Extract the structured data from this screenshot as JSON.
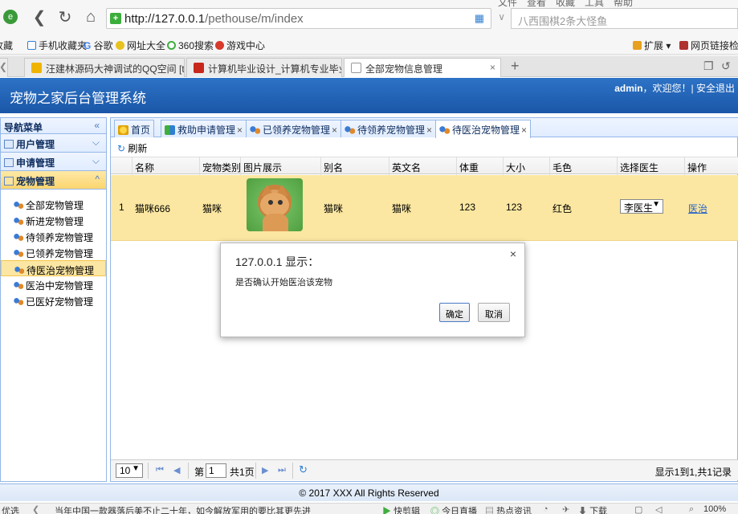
{
  "browser": {
    "top_menu": "文件　查看　收藏　工具　帮助",
    "url_host": "http://127.0.0.1",
    "url_path": "/pethouse/m/index",
    "search_text": "八西围棋2条大怪鱼",
    "bookmarks": {
      "collection": "收藏",
      "mobile": "手机收藏夹",
      "google": "谷歌",
      "daquan": "网址大全",
      "search360": "360搜索",
      "games": "游戏中心",
      "extend": "扩展",
      "translate": "网页链接检"
    },
    "tabs": [
      {
        "label": "汪建林源码大神调试的QQ空间 [t"
      },
      {
        "label": "计算机毕业设计_计算机专业毕业"
      },
      {
        "label": "全部宠物信息管理"
      }
    ]
  },
  "app": {
    "title": "宠物之家后台管理系统",
    "user": "admin",
    "welcome": "，欢迎您！| 安全退出"
  },
  "sidebar": {
    "header": "导航菜单",
    "groups": [
      {
        "label": "用户管理"
      },
      {
        "label": "申请管理"
      },
      {
        "label": "宠物管理"
      }
    ],
    "items": [
      {
        "label": "全部宠物管理"
      },
      {
        "label": "新进宠物管理"
      },
      {
        "label": "待领养宠物管理"
      },
      {
        "label": "已领养宠物管理"
      },
      {
        "label": "待医治宠物管理"
      },
      {
        "label": "医治中宠物管理"
      },
      {
        "label": "已医好宠物管理"
      }
    ]
  },
  "main_tabs": [
    {
      "label": "首页"
    },
    {
      "label": "救助申请管理"
    },
    {
      "label": "已领养宠物管理"
    },
    {
      "label": "待领养宠物管理"
    },
    {
      "label": "待医治宠物管理"
    }
  ],
  "toolbar": {
    "refresh": "刷新"
  },
  "grid": {
    "columns": [
      "名称",
      "宠物类别",
      "图片展示",
      "别名",
      "英文名",
      "体重",
      "大小",
      "毛色",
      "选择医生",
      "操作"
    ],
    "rows": [
      {
        "index": "1",
        "name": "猫咪666",
        "type": "猫咪",
        "alias": "猫咪",
        "english": "猫咪",
        "weight": "123",
        "size": "123",
        "color": "红色",
        "doctor": "李医生",
        "action": "医治"
      }
    ]
  },
  "dialog": {
    "title": "127.0.0.1 显示：",
    "message": "是否确认开始医治该宠物",
    "ok": "确定",
    "cancel": "取消",
    "close": "×"
  },
  "pager": {
    "page_size": "10",
    "page_label": "第",
    "page_value": "1",
    "total_pages": "共1页",
    "summary": "显示1到1,共1记录"
  },
  "footer": {
    "text": "© 2017 XXX All Rights Reserved"
  },
  "statusbar": {
    "left": "优选",
    "news": "当年中国一款器落后美不止二十年，如今解放军用的要比其更先进",
    "kuaijian": "快剪辑",
    "live": "今日直播",
    "hot": "热点资讯",
    "download": "下载",
    "zoom": "100%"
  }
}
